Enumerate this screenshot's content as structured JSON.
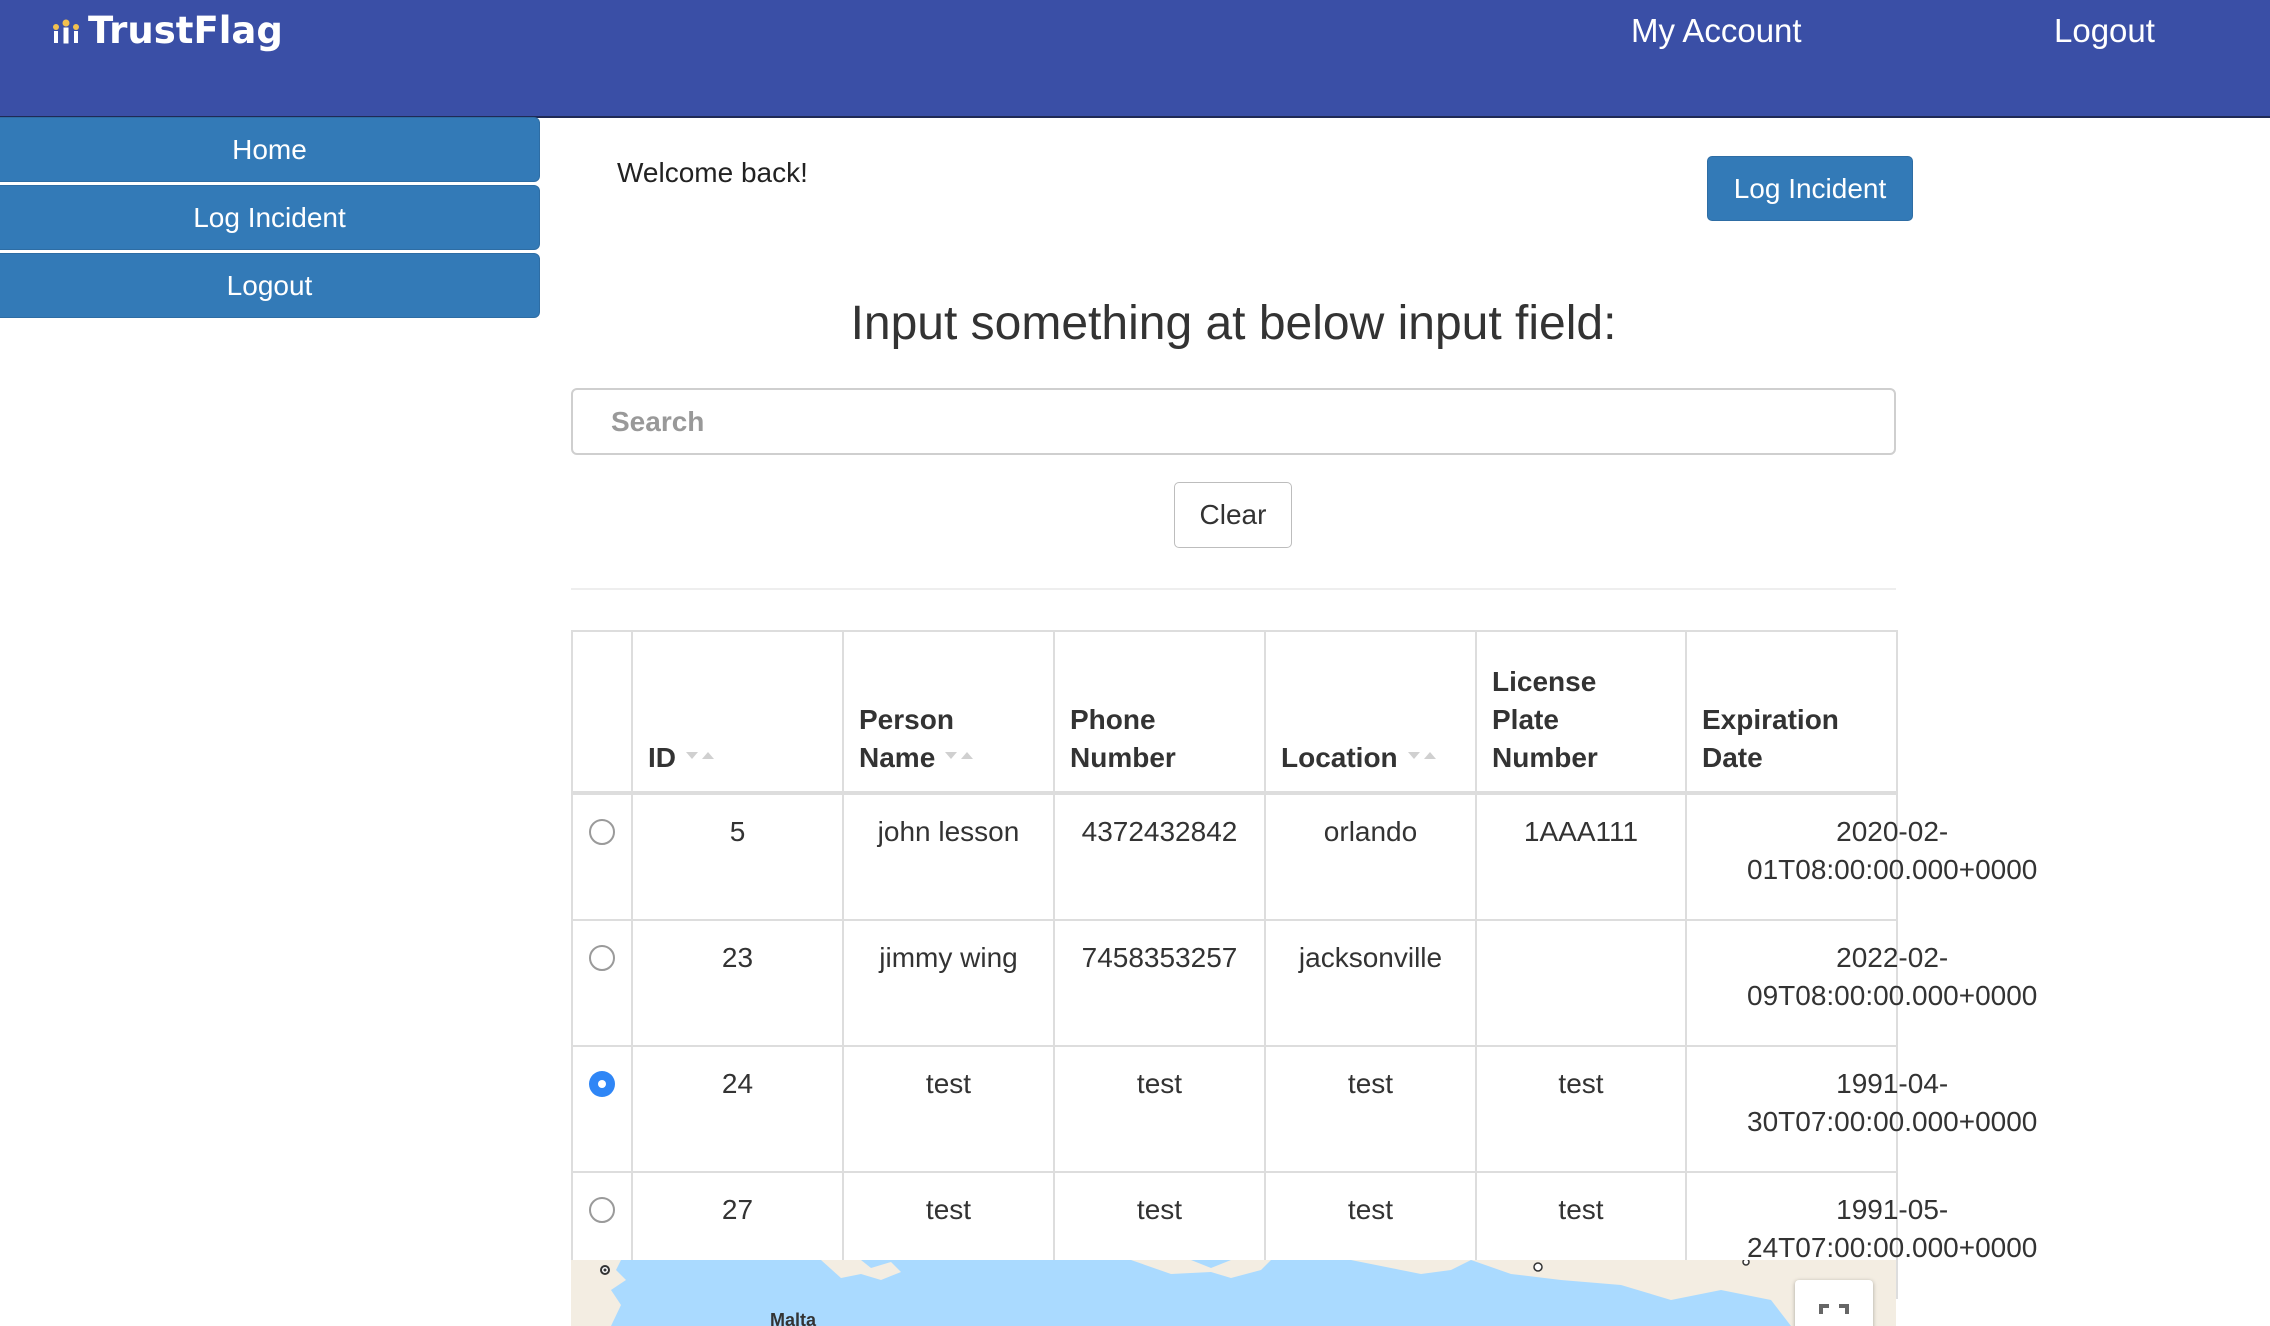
{
  "header": {
    "brand": "TrustFlag",
    "links": [
      "My Account",
      "Logout"
    ]
  },
  "sidebar": {
    "items": [
      {
        "label": "Home"
      },
      {
        "label": "Log Incident"
      },
      {
        "label": "Logout"
      }
    ]
  },
  "main": {
    "welcome": "Welcome back!",
    "log_incident_button": "Log Incident",
    "headline": "Input something at below input field:",
    "search": {
      "placeholder": "Search",
      "value": ""
    },
    "clear_button": "Clear"
  },
  "table": {
    "columns": [
      {
        "key": "select",
        "lines": [],
        "sortable": false
      },
      {
        "key": "id",
        "lines": [
          "ID"
        ],
        "sortable": true
      },
      {
        "key": "person_name",
        "lines": [
          "Person",
          "Name"
        ],
        "sortable": true
      },
      {
        "key": "phone_number",
        "lines": [
          "Phone",
          "Number"
        ],
        "sortable": false
      },
      {
        "key": "location",
        "lines": [
          "Location"
        ],
        "sortable": true
      },
      {
        "key": "license_plate",
        "lines": [
          "License",
          "Plate",
          "Number"
        ],
        "sortable": false
      },
      {
        "key": "expiration_date",
        "lines": [
          "Expiration",
          "Date"
        ],
        "sortable": false
      }
    ],
    "rows": [
      {
        "selected": false,
        "id": "5",
        "person_name": "john lesson",
        "phone_number": "4372432842",
        "location": "orlando",
        "license_plate": "1AAA111",
        "expiration_date": [
          "2020-02-",
          "01T08:00:00.000+0000"
        ]
      },
      {
        "selected": false,
        "id": "23",
        "person_name": "jimmy wing",
        "phone_number": "7458353257",
        "location": "jacksonville",
        "license_plate": "",
        "expiration_date": [
          "2022-02-",
          "09T08:00:00.000+0000"
        ]
      },
      {
        "selected": true,
        "id": "24",
        "person_name": "test",
        "phone_number": "test",
        "location": "test",
        "license_plate": "test",
        "expiration_date": [
          "1991-04-",
          "30T07:00:00.000+0000"
        ]
      },
      {
        "selected": false,
        "id": "27",
        "person_name": "test",
        "phone_number": "test",
        "location": "test",
        "license_plate": "test",
        "expiration_date": [
          "1991-05-",
          "24T07:00:00.000+0000"
        ]
      }
    ]
  },
  "map": {
    "label": "Malta",
    "fullscreen_icon": "fullscreen-icon"
  },
  "colors": {
    "navbar": "#3a4fa6",
    "button_primary": "#337ab7",
    "radio_checked": "#2f86f6",
    "water": "#aadaff"
  }
}
